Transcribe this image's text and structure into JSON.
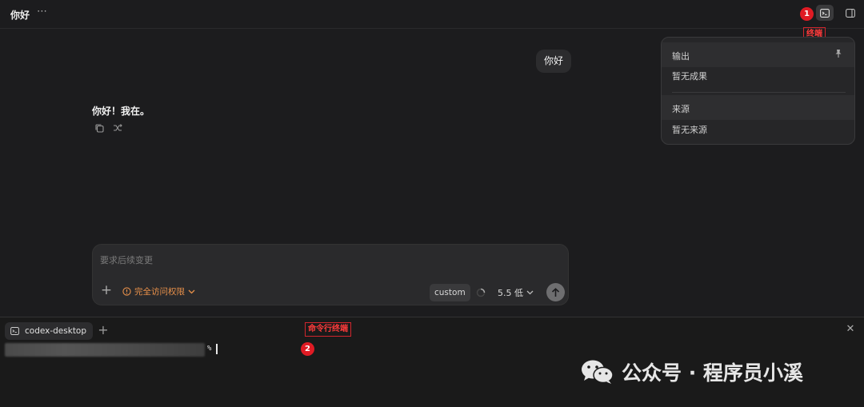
{
  "header": {
    "title": "你好",
    "more_icon": "more-horizontal-icon"
  },
  "conversation": {
    "user_message": "你好",
    "assistant_message": "你好！我在。"
  },
  "composer": {
    "placeholder": "要求后续变更",
    "access_label": "完全访问权限",
    "custom_label": "custom",
    "model_label": "5.5 低"
  },
  "side_panel": {
    "output_title": "输出",
    "output_empty": "暂无成果",
    "sources_title": "来源",
    "sources_empty": "暂无来源"
  },
  "terminal": {
    "tab_label": "codex-desktop",
    "prompt_symbol": "%"
  },
  "annotations": {
    "badge_1": "1",
    "label_1": "终端",
    "badge_2": "2",
    "label_2": "命令行终端"
  },
  "watermark": {
    "text": "公众号 · 程序员小溪"
  },
  "colors": {
    "background": "#1c1c1e",
    "accent_warning": "#e8904a",
    "annotation_red": "#e01b24"
  }
}
